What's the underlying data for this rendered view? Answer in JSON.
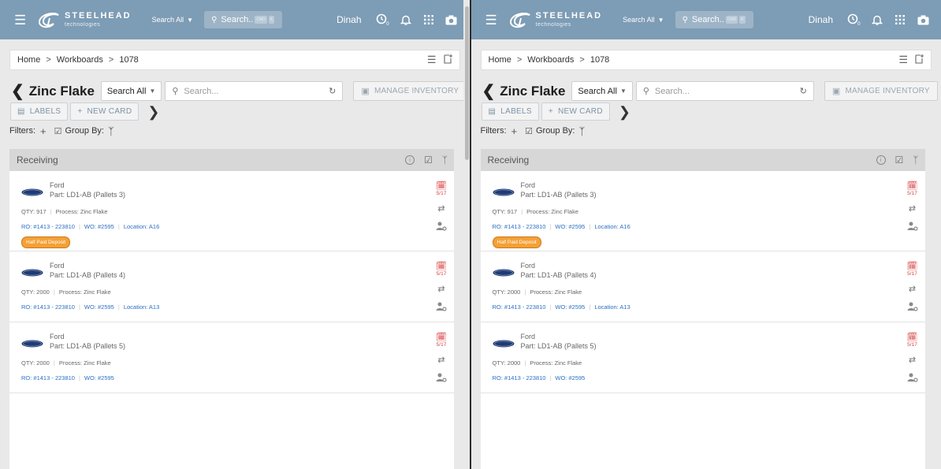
{
  "topbar": {
    "brand": "STEELHEAD",
    "brand_sub": "technologies",
    "search_scope": "Search All",
    "search_label": "Search..",
    "kbd_cmd": "CMD",
    "kbd_k": "K",
    "user": "Dinah",
    "clock_badge": "0"
  },
  "breadcrumb": [
    "Home",
    "Workboards",
    "1078"
  ],
  "breadcrumb_sep": ">",
  "board": {
    "title": "Zinc Flake",
    "search_scope": "Search All",
    "search_placeholder": "Search...",
    "manage_inventory": "MANAGE INVENTORY",
    "labels_btn": "LABELS",
    "new_card_btn": "NEW CARD",
    "filters_label": "Filters:",
    "group_by_label": "Group By:"
  },
  "column": {
    "name": "Receiving",
    "cards": [
      {
        "customer": "Ford",
        "part": "Part: LD1-AB (Pallets 3)",
        "qty": "QTY: 917",
        "process": "Process: Zinc Flake",
        "ro": "RO: #1413 - 223810",
        "wo": "WO: #2595",
        "location": "Location: A16",
        "badge": "Half Paid Deposit",
        "due": "5/17"
      },
      {
        "customer": "Ford",
        "part": "Part: LD1-AB (Pallets 4)",
        "qty": "QTY: 2000",
        "process": "Process: Zinc Flake",
        "ro": "RO: #1413 - 223810",
        "wo": "WO: #2595",
        "location": "Location: A13",
        "due": "5/17"
      },
      {
        "customer": "Ford",
        "part": "Part: LD1-AB (Pallets 5)",
        "qty": "QTY: 2000",
        "process": "Process: Zinc Flake",
        "ro": "RO: #1413 - 223810",
        "wo": "WO: #2595",
        "due": "5/17"
      }
    ]
  },
  "colors": {
    "topbar": "#7d9cb5",
    "link": "#2a6fc2",
    "due": "#d84040",
    "badge": "#f5a035",
    "column_header": "#d7d7d7"
  },
  "icons": [
    "menu-icon",
    "steelhead-logo-icon",
    "search-icon",
    "clock-icon",
    "bell-icon",
    "apps-grid-icon",
    "camera-icon",
    "list-view-icon",
    "bookmark-icon",
    "back-chevron-icon",
    "refresh-icon",
    "inventory-box-icon",
    "labels-icon",
    "plus-icon",
    "forward-chevron-icon",
    "group-by-icon",
    "info-icon",
    "checklist-icon",
    "calendar-icon",
    "transfer-icon",
    "assign-user-icon",
    "ford-logo-icon"
  ]
}
